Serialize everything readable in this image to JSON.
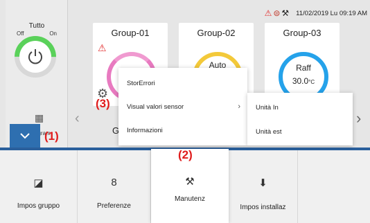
{
  "status": {
    "datetime": "11/02/2019 Lu 09:19 AM",
    "icons": [
      "warning-icon",
      "error-icon",
      "maintenance-icon"
    ]
  },
  "power": {
    "label": "Tutto",
    "off": "Off",
    "on": "On"
  },
  "groups": [
    {
      "name": "Group-01",
      "mode": "",
      "temp": ""
    },
    {
      "name": "Group-02",
      "mode": "Auto",
      "temp": ""
    },
    {
      "name": "Group-03",
      "mode": "Raff",
      "temp": "30.0",
      "unit": "°C"
    }
  ],
  "lower_group_initial": "G",
  "program_label": "Program",
  "annotations": {
    "a1": "(1)",
    "a2": "(2)",
    "a3": "(3)"
  },
  "menu": {
    "items": [
      "StorErrori",
      "Visual valori sensor",
      "Informazioni"
    ],
    "submenu": [
      "Unità In",
      "Unità est"
    ]
  },
  "toolbar": {
    "items": [
      "Impos gruppo",
      "Preferenze",
      "Manutenz",
      "Impos installaz"
    ]
  },
  "colors": {
    "accent_blue": "#2e6fb0",
    "power_green": "#5ad15a",
    "ring_pink": "#e87ac0",
    "ring_yellow": "#f3c93a",
    "ring_blue": "#25a2ea",
    "annotation_red": "#e01c1c"
  }
}
